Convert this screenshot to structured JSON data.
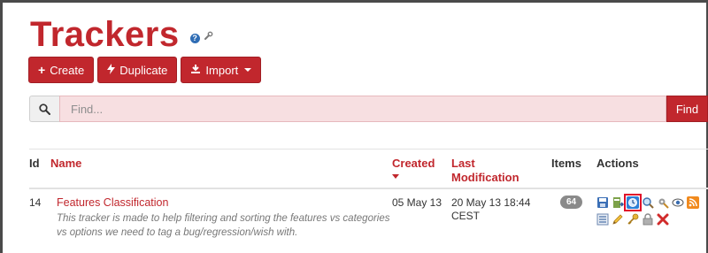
{
  "page": {
    "title": "Trackers"
  },
  "toolbar": {
    "create_label": "Create",
    "duplicate_label": "Duplicate",
    "import_label": "Import"
  },
  "search": {
    "placeholder": "Find...",
    "value": "",
    "find_label": "Find"
  },
  "table": {
    "columns": {
      "id": "Id",
      "name": "Name",
      "created": "Created",
      "last_modification": "Last Modification",
      "items": "Items",
      "actions": "Actions"
    },
    "rows": [
      {
        "id": "14",
        "name": "Features Classification",
        "description": "This tracker is made to help filtering and sorting the features vs categories vs options we need to tag a bug/regression/wish with.",
        "created": "05 May 13",
        "last_modification_line1": "20 May 13 18:44",
        "last_modification_line2": "CEST",
        "items": "64"
      }
    ]
  },
  "icons": {
    "actions_row1": [
      "save-icon",
      "export-icon",
      "clock-icon",
      "search-icon",
      "tools-icon",
      "view-icon",
      "rss-icon"
    ],
    "actions_row2": [
      "list-icon",
      "edit-icon",
      "key-icon",
      "lock-icon",
      "delete-icon"
    ]
  },
  "colors": {
    "accent": "#c1272d",
    "search_bg": "#f7dfe1",
    "badge": "#8a8a8a",
    "highlight_border": "#e0102a"
  }
}
